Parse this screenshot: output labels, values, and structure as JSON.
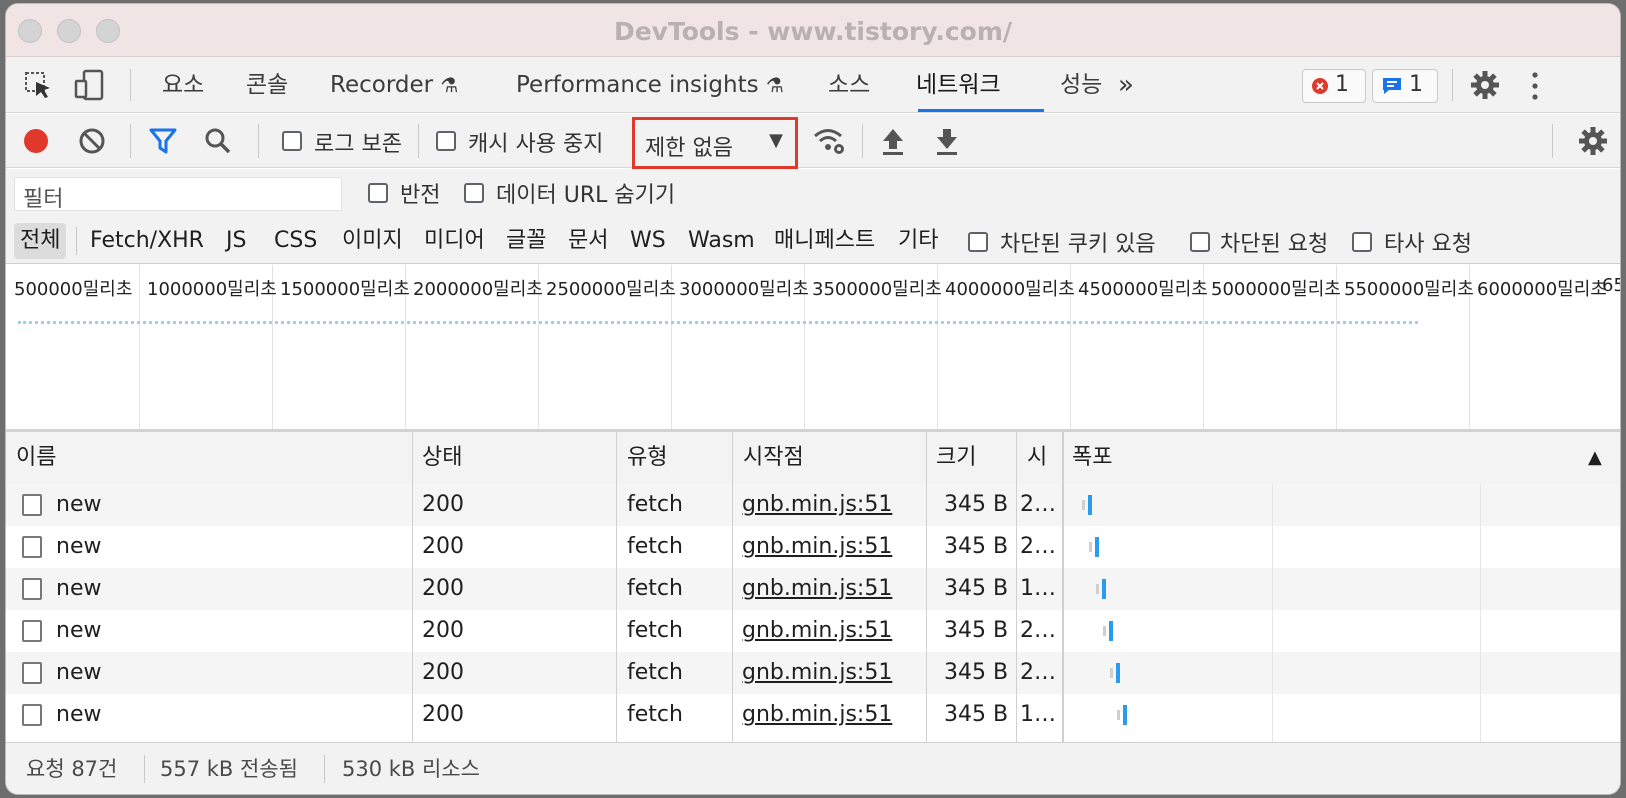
{
  "window": {
    "title": "DevTools - www.tistory.com/"
  },
  "tabs": [
    {
      "label": "요소"
    },
    {
      "label": "콘솔"
    },
    {
      "label": "Recorder"
    },
    {
      "label": "Performance insights"
    },
    {
      "label": "소스"
    },
    {
      "label": "네트워크"
    },
    {
      "label": "성능"
    }
  ],
  "tabs_more": "»",
  "badges": {
    "errors": "1",
    "messages": "1"
  },
  "toolbar": {
    "preserve_log": "로그 보존",
    "disable_cache": "캐시 사용 중지",
    "throttling": "제한 없음"
  },
  "filter": {
    "placeholder": "필터",
    "invert": "반전",
    "hide_data_urls": "데이터 URL 숨기기"
  },
  "types": [
    "전체",
    "Fetch/XHR",
    "JS",
    "CSS",
    "이미지",
    "미디어",
    "글꼴",
    "문서",
    "WS",
    "Wasm",
    "매니페스트",
    "기타"
  ],
  "type_checks": [
    "차단된 쿠키 있음",
    "차단된 요청",
    "타사 요청"
  ],
  "overview_ticks": [
    "500000밀리초",
    "1000000밀리초",
    "1500000밀리초",
    "2000000밀리초",
    "2500000밀리초",
    "3000000밀리초",
    "3500000밀리초",
    "4000000밀리초",
    "4500000밀리초",
    "5000000밀리초",
    "5500000밀리초",
    "6000000밀리초",
    "65"
  ],
  "columns": {
    "name": "이름",
    "status": "상태",
    "type": "유형",
    "initiator": "시작점",
    "size": "크기",
    "time": "시",
    "waterfall": "폭포"
  },
  "rows": [
    {
      "name": "new",
      "status": "200",
      "type": "fetch",
      "initiator": "gnb.min.js:51",
      "size": "345 B",
      "time": "2…"
    },
    {
      "name": "new",
      "status": "200",
      "type": "fetch",
      "initiator": "gnb.min.js:51",
      "size": "345 B",
      "time": "2…"
    },
    {
      "name": "new",
      "status": "200",
      "type": "fetch",
      "initiator": "gnb.min.js:51",
      "size": "345 B",
      "time": "1…"
    },
    {
      "name": "new",
      "status": "200",
      "type": "fetch",
      "initiator": "gnb.min.js:51",
      "size": "345 B",
      "time": "2…"
    },
    {
      "name": "new",
      "status": "200",
      "type": "fetch",
      "initiator": "gnb.min.js:51",
      "size": "345 B",
      "time": "2…"
    },
    {
      "name": "new",
      "status": "200",
      "type": "fetch",
      "initiator": "gnb.min.js:51",
      "size": "345 B",
      "time": "1…"
    }
  ],
  "status": {
    "requests": "요청 87건",
    "transferred": "557 kB 전송됨",
    "resources": "530 kB 리소스"
  }
}
